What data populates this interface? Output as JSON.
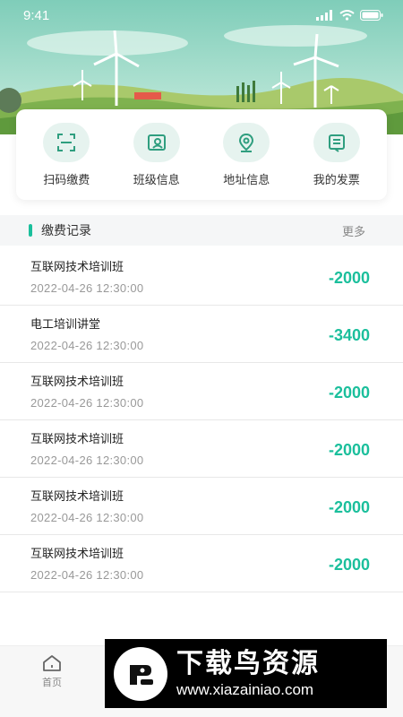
{
  "status_bar": {
    "time": "9:41"
  },
  "quick_actions": [
    {
      "label": "扫码缴费",
      "icon": "scan-icon"
    },
    {
      "label": "班级信息",
      "icon": "id-card-icon"
    },
    {
      "label": "地址信息",
      "icon": "location-pin-icon"
    },
    {
      "label": "我的发票",
      "icon": "invoice-icon"
    }
  ],
  "section": {
    "title": "缴费记录",
    "more": "更多"
  },
  "records": [
    {
      "name": "互联网技术培训班",
      "time": "2022-04-26  12:30:00",
      "amount": "-2000"
    },
    {
      "name": "电工培训讲堂",
      "time": "2022-04-26  12:30:00",
      "amount": "-3400"
    },
    {
      "name": "互联网技术培训班",
      "time": "2022-04-26  12:30:00",
      "amount": "-2000"
    },
    {
      "name": "互联网技术培训班",
      "time": "2022-04-26  12:30:00",
      "amount": "-2000"
    },
    {
      "name": "互联网技术培训班",
      "time": "2022-04-26  12:30:00",
      "amount": "-2000"
    },
    {
      "name": "互联网技术培训班",
      "time": "2022-04-26  12:30:00",
      "amount": "-2000"
    }
  ],
  "tab_bar": {
    "home_label": "首页"
  },
  "watermark": {
    "title": "下载鸟资源",
    "url": "www.xiazainiao.com"
  },
  "colors": {
    "accent": "#1bbf9c",
    "icon_bg": "#e6f3ef",
    "banner_sky": "#8fd6c4"
  }
}
